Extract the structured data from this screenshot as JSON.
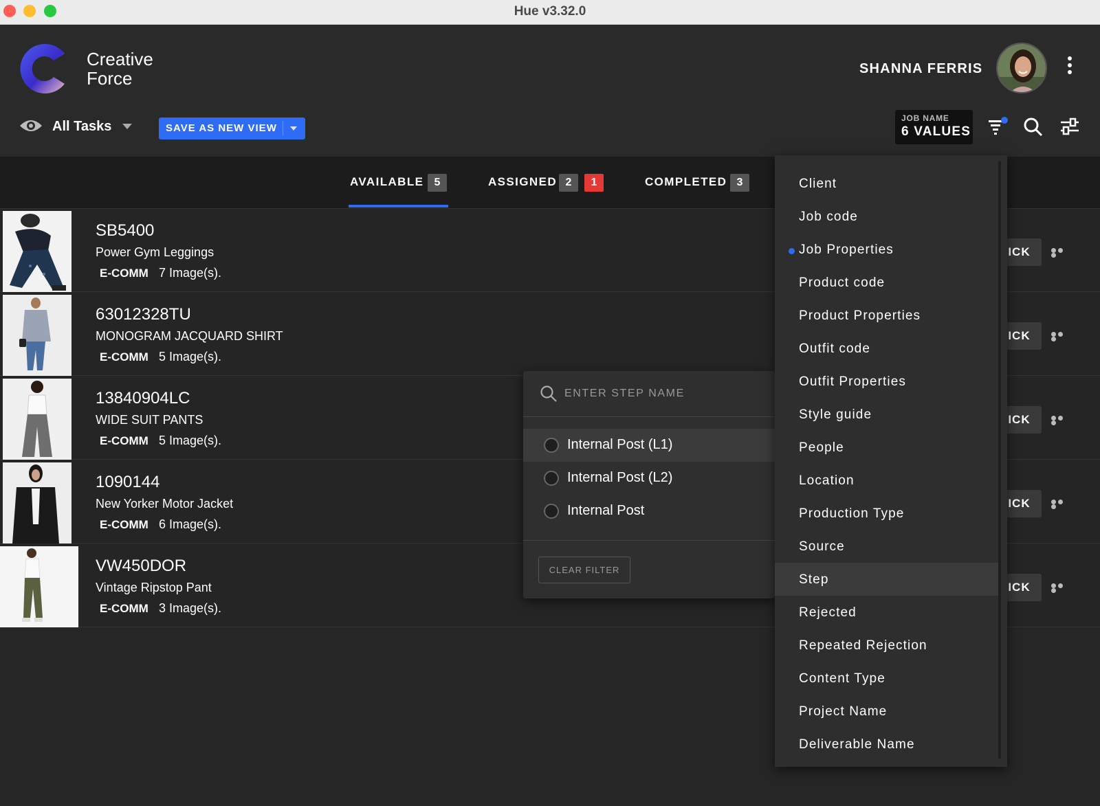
{
  "window": {
    "title": "Hue v3.32.0"
  },
  "brand": {
    "name_line1": "Creative",
    "name_line2": "Force"
  },
  "user": {
    "name": "SHANNA FERRIS"
  },
  "toolbar": {
    "view_name": "All Tasks",
    "save_label": "SAVE AS NEW VIEW",
    "filter_chip": {
      "label": "JOB NAME",
      "value": "6 VALUES"
    }
  },
  "tabs": [
    {
      "label": "AVAILABLE",
      "count": "5"
    },
    {
      "label": "ASSIGNED",
      "count": "2",
      "alert": "1"
    },
    {
      "label": "COMPLETED",
      "count": "3"
    }
  ],
  "tasks": [
    {
      "code": "SB5400",
      "name": "Power Gym Leggings",
      "type": "E-COMM",
      "count": "7 Image(s).",
      "action": "PICK"
    },
    {
      "code": "63012328TU",
      "name": "MONOGRAM JACQUARD SHIRT",
      "type": "E-COMM",
      "count": "5 Image(s).",
      "action": "PICK"
    },
    {
      "code": "13840904LC",
      "name": "WIDE SUIT PANTS",
      "type": "E-COMM",
      "count": "5 Image(s).",
      "action": "PICK"
    },
    {
      "code": "1090144",
      "name": "New Yorker Motor Jacket",
      "type": "E-COMM",
      "count": "6 Image(s).",
      "action": "PICK"
    },
    {
      "code": "VW450DOR",
      "name": "Vintage Ripstop Pant",
      "type": "E-COMM",
      "count": "3 Image(s).",
      "action": "PICK"
    }
  ],
  "step_filter": {
    "placeholder": "ENTER STEP NAME",
    "options": [
      "Internal Post (L1)",
      "Internal Post (L2)",
      "Internal Post"
    ],
    "clear_label": "CLEAR FILTER"
  },
  "field_menu": {
    "items": [
      "Client",
      "Job code",
      "Job Properties",
      "Product code",
      "Product Properties",
      "Outfit code",
      "Outfit Properties",
      "Style guide",
      "People",
      "Location",
      "Production Type",
      "Source",
      "Step",
      "Rejected",
      "Repeated Rejection",
      "Content Type",
      "Project Name",
      "Deliverable Name"
    ],
    "marked": "Job Properties",
    "highlighted": "Step"
  },
  "colors": {
    "accent": "#2f6cf5",
    "alert": "#e53935",
    "background": "#262626"
  },
  "icons": [
    "eye-icon",
    "filter-icon",
    "search-icon",
    "sliders-icon",
    "kebab-icon",
    "more-icon"
  ]
}
